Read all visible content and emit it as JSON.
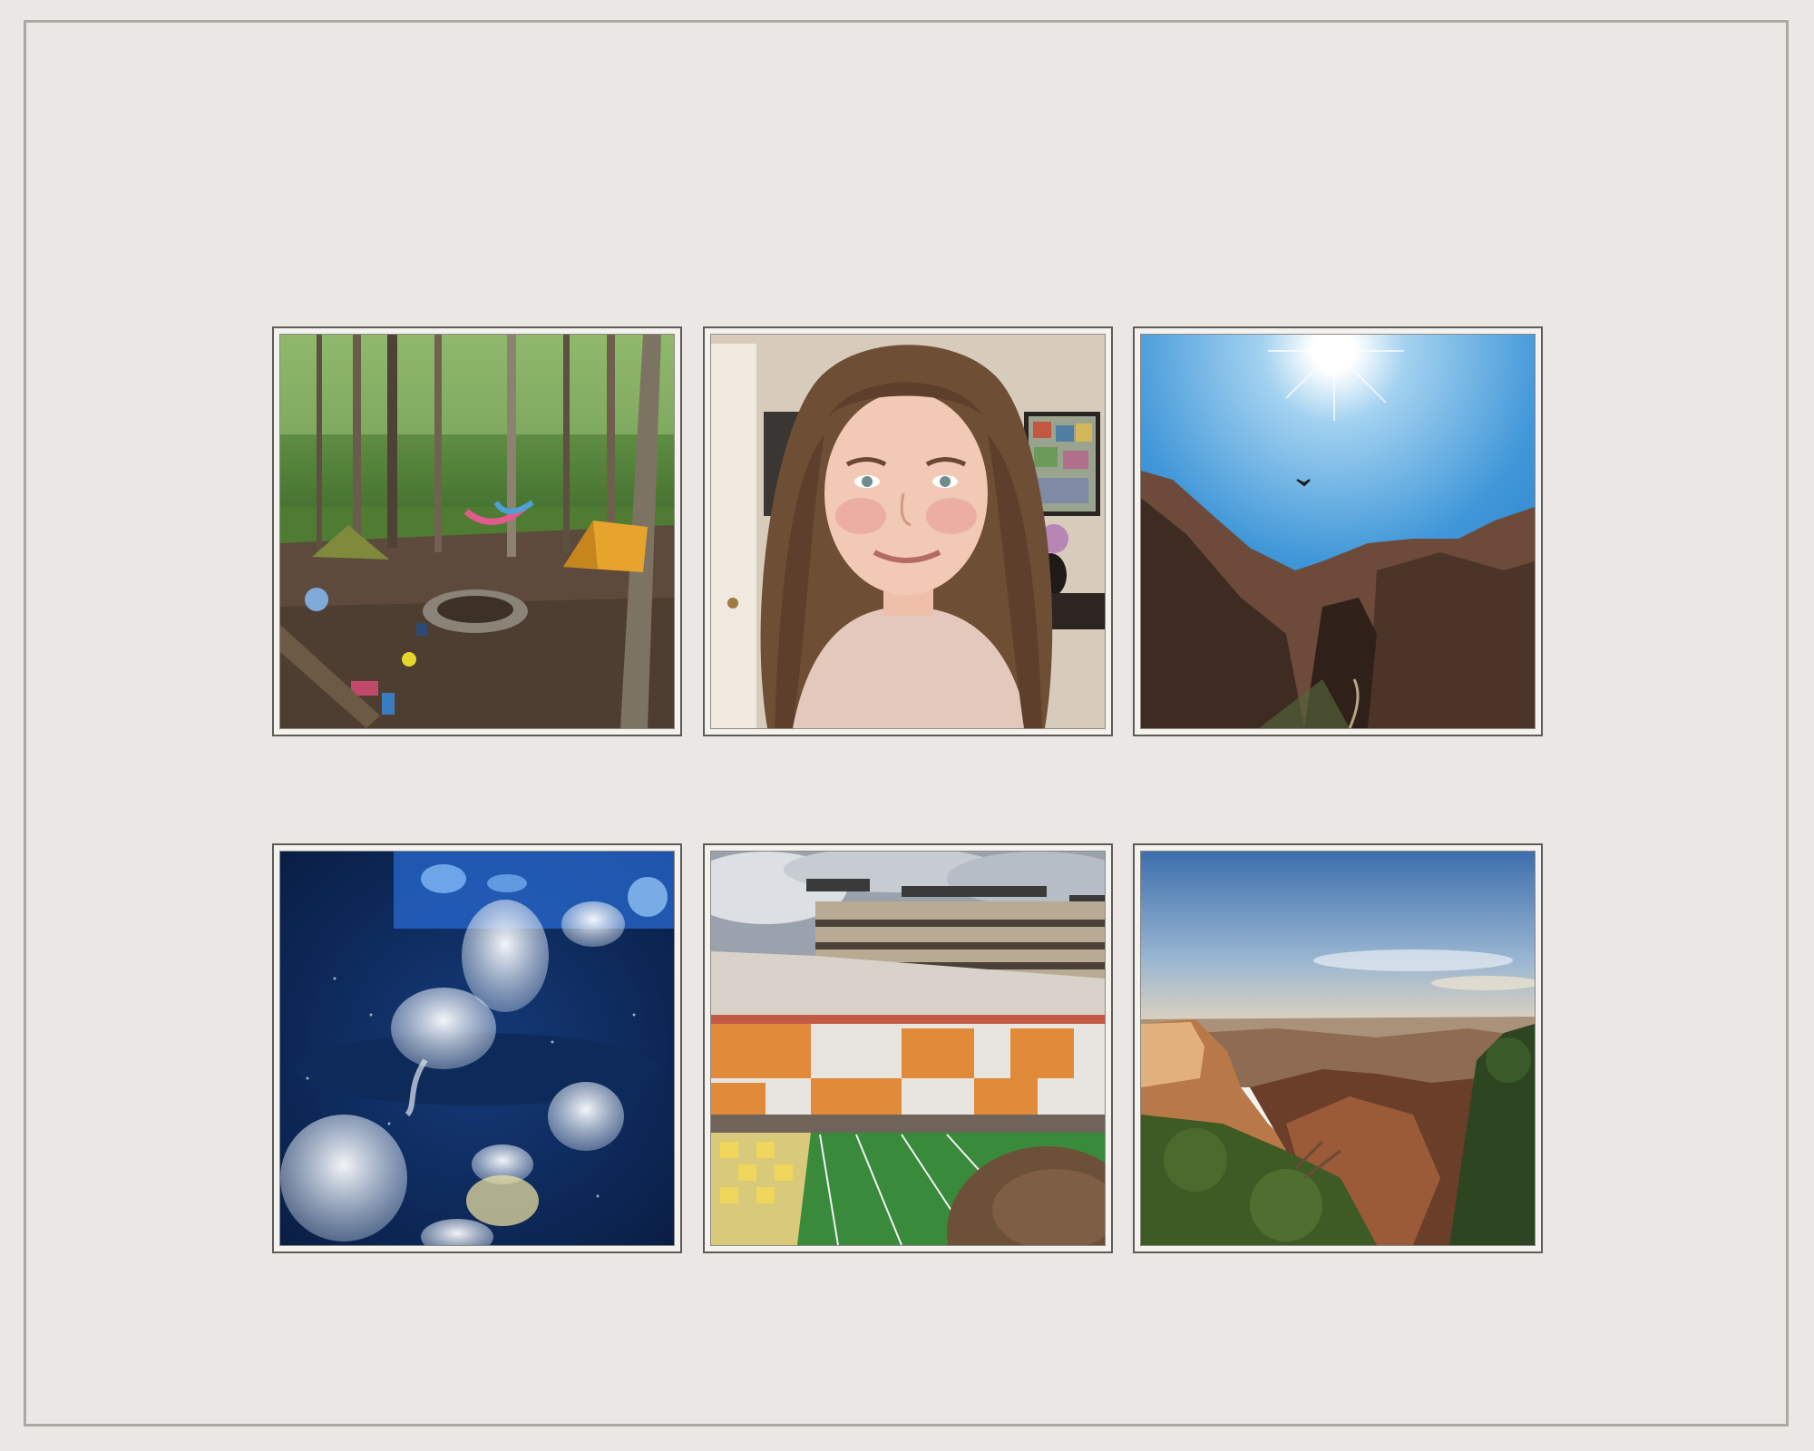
{
  "page": {
    "background_color": "#ebe7e4",
    "frame_color": "#a9aaa3"
  },
  "photos": [
    {
      "subject": "forest-campsite-photo"
    },
    {
      "subject": "selfie-portrait-photo"
    },
    {
      "subject": "canyon-sun-bird-photo"
    },
    {
      "subject": "jellyfish-aquarium-photo"
    },
    {
      "subject": "football-stadium-photo"
    },
    {
      "subject": "grand-canyon-sunset-photo"
    }
  ]
}
